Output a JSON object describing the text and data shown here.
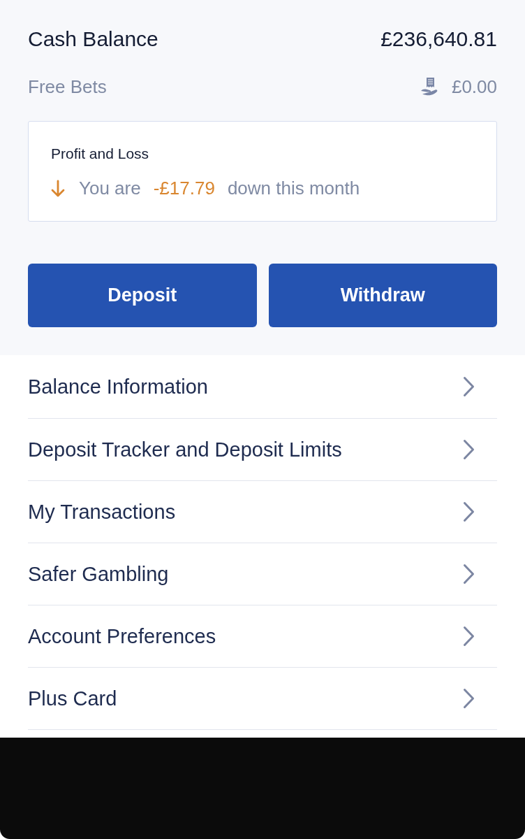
{
  "balances": [
    {
      "kind": "cash",
      "label": "Cash Balance",
      "amount": "£236,640.81"
    },
    {
      "kind": "free_bets",
      "label": "Free Bets",
      "amount": "£0.00"
    }
  ],
  "profit_loss": {
    "title": "Profit and Loss",
    "loss": true,
    "prefix": "You are",
    "amount": "-£17.79",
    "suffix": "down this month"
  },
  "buttons": [
    {
      "label": "Deposit"
    },
    {
      "label": "Withdraw"
    }
  ],
  "menu": [
    {
      "label": "Balance Information"
    },
    {
      "label": "Deposit Tracker and Deposit Limits"
    },
    {
      "label": "My Transactions"
    },
    {
      "label": "Safer Gambling"
    },
    {
      "label": "Account Preferences"
    },
    {
      "label": "Plus Card"
    }
  ]
}
